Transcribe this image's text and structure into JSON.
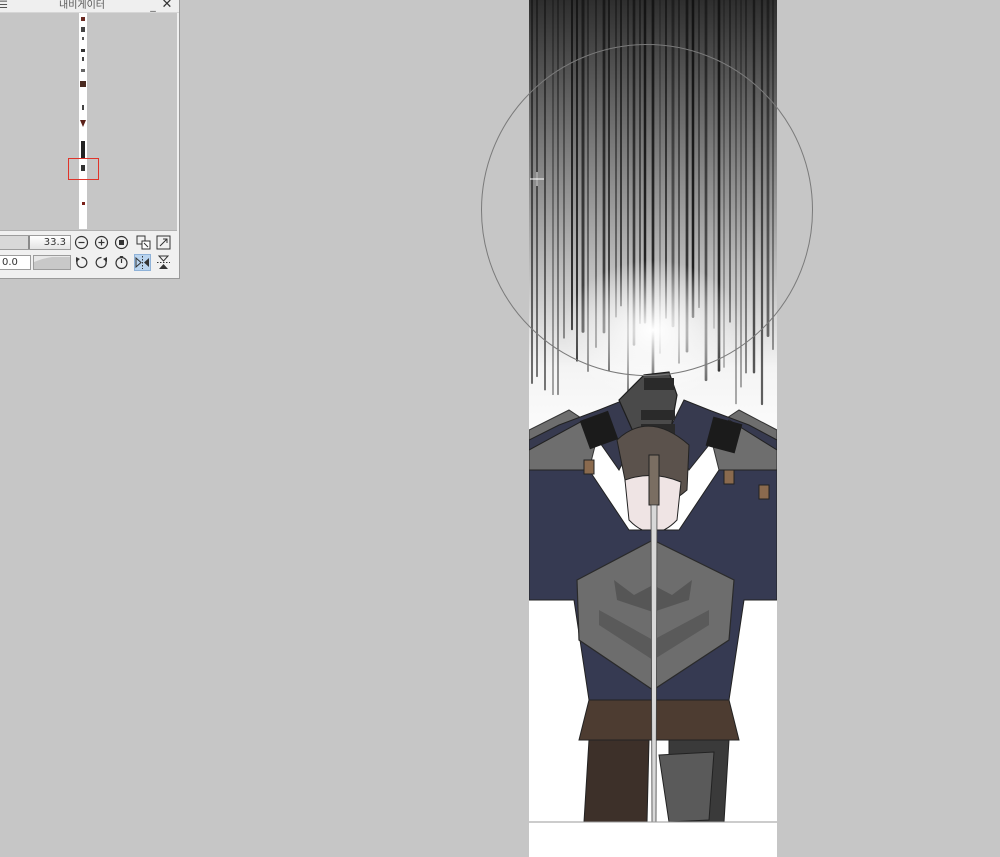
{
  "navigator": {
    "title": "내비게이터",
    "menu_glyph": "☰",
    "minimize_glyph": "_",
    "close_glyph": "✕",
    "zoom_value": "33.3",
    "rotation_value": "0.0",
    "icons": {
      "zoom_out": "zoom-out-icon",
      "zoom_in": "zoom-in-icon",
      "actual_size": "actual-size-icon",
      "fit_window": "fit-window-icon",
      "fit_screen": "fit-screen-icon",
      "rotate_left": "rotate-left-icon",
      "rotate_right": "rotate-right-icon",
      "reset_rotation": "reset-rotation-icon",
      "flip_horizontal": "flip-horizontal-icon",
      "flip_vertical": "flip-vertical-icon"
    },
    "flip_horizontal_active": true
  },
  "canvas": {
    "background": "#ffffff",
    "workspace_color": "#c6c6c6"
  }
}
